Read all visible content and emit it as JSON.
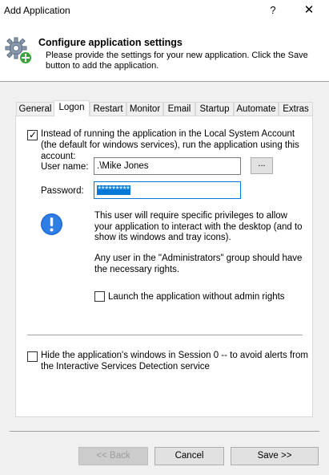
{
  "window": {
    "title": "Add Application",
    "help_label": "?",
    "close_label": "✕"
  },
  "header": {
    "title": "Configure application settings",
    "description": "Please provide the settings for your new application. Click the Save button to add the application."
  },
  "tabs": [
    {
      "label": "General"
    },
    {
      "label": "Logon"
    },
    {
      "label": "Restart"
    },
    {
      "label": "Monitor"
    },
    {
      "label": "Email"
    },
    {
      "label": "Startup"
    },
    {
      "label": "Automate"
    },
    {
      "label": "Extras"
    }
  ],
  "active_tab": "Logon",
  "logon": {
    "run_as_checked": true,
    "run_as_label": "Instead of running the application in the Local System Account (the default for windows services), run the application using this account:",
    "username_label": "User name:",
    "username_value": ".\\Mike Jones",
    "browse_label": "...",
    "password_label": "Password:",
    "password_value": "*********",
    "info_text_1": "This user will require specific privileges to allow your application to interact with the desktop (and to show its windows and tray icons).",
    "info_text_2": "Any user in the \"Administrators\" group should have the necessary rights.",
    "launch_without_admin_checked": false,
    "launch_without_admin_label": "Launch the application without admin rights",
    "hide_session0_checked": false,
    "hide_session0_label": "Hide the application's windows in Session 0 -- to avoid alerts from the Interactive Services Detection service"
  },
  "buttons": {
    "back": "<< Back",
    "cancel": "Cancel",
    "save": "Save >>"
  }
}
